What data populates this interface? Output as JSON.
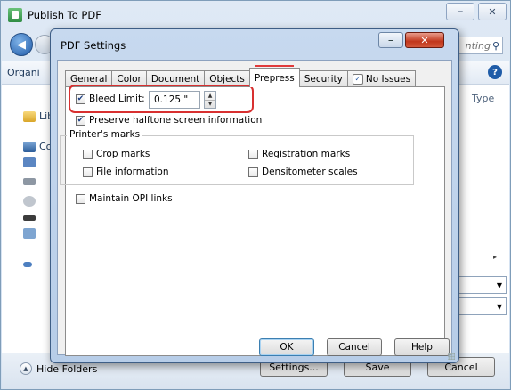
{
  "outer": {
    "title": "Publish To PDF",
    "search_tail": "nting",
    "organize_label": "Organi",
    "type_column": "Type",
    "nav_items": [
      "Lib",
      "Co"
    ],
    "hide_folders": "Hide Folders",
    "settings_btn": "Settings...",
    "save_btn": "Save",
    "cancel_btn": "Cancel"
  },
  "dialog": {
    "title": "PDF Settings",
    "tabs": [
      {
        "label": "General"
      },
      {
        "label": "Color"
      },
      {
        "label": "Document"
      },
      {
        "label": "Objects"
      },
      {
        "label": "Prepress",
        "active": true
      },
      {
        "label": "Security"
      },
      {
        "label": "No Issues",
        "icon": "issues-check-icon"
      }
    ],
    "prepress": {
      "bleed_limit": {
        "label": "Bleed Limit:",
        "checked": true,
        "value": "0.125 \""
      },
      "preserve_halftone": {
        "label": "Preserve halftone screen information",
        "checked": true
      },
      "printers_marks": {
        "group_label": "Printer's marks",
        "crop_marks": {
          "label": "Crop marks",
          "checked": false
        },
        "file_information": {
          "label": "File information",
          "checked": false
        },
        "registration_marks": {
          "label": "Registration marks",
          "checked": false
        },
        "densitometer_scales": {
          "label": "Densitometer scales",
          "checked": false
        }
      },
      "maintain_opi": {
        "label": "Maintain OPI links",
        "checked": false
      }
    },
    "buttons": {
      "ok": "OK",
      "cancel": "Cancel",
      "help": "Help"
    }
  },
  "colors": {
    "highlight": "#d83030",
    "tab_indicator": "#e03a3a"
  }
}
